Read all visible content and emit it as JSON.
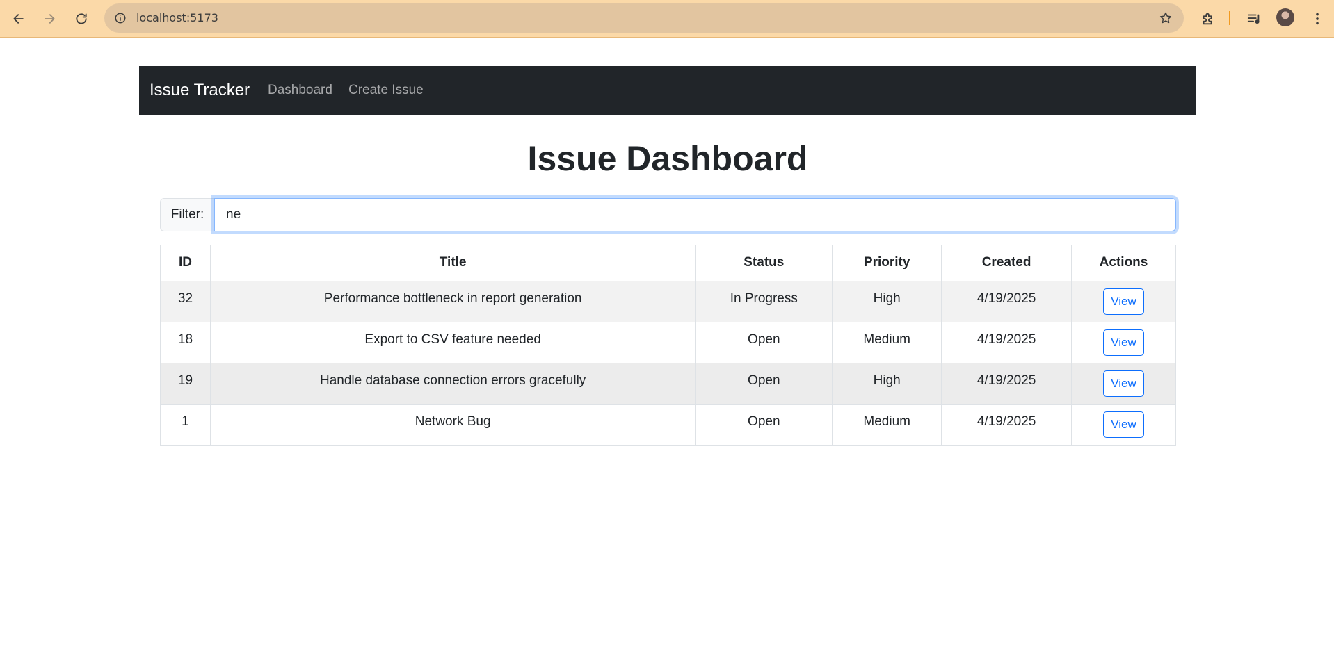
{
  "browser": {
    "url": "localhost:5173"
  },
  "navbar": {
    "brand": "Issue Tracker",
    "links": [
      "Dashboard",
      "Create Issue"
    ]
  },
  "page": {
    "title": "Issue Dashboard"
  },
  "filter": {
    "label": "Filter:",
    "value": "ne"
  },
  "table": {
    "headers": [
      "ID",
      "Title",
      "Status",
      "Priority",
      "Created",
      "Actions"
    ],
    "rows": [
      {
        "id": "32",
        "title": "Performance bottleneck in report generation",
        "status": "In Progress",
        "priority": "High",
        "created": "4/19/2025",
        "action": "View"
      },
      {
        "id": "18",
        "title": "Export to CSV feature needed",
        "status": "Open",
        "priority": "Medium",
        "created": "4/19/2025",
        "action": "View"
      },
      {
        "id": "19",
        "title": "Handle database connection errors gracefully",
        "status": "Open",
        "priority": "High",
        "created": "4/19/2025",
        "action": "View"
      },
      {
        "id": "1",
        "title": "Network Bug",
        "status": "Open",
        "priority": "Medium",
        "created": "4/19/2025",
        "action": "View"
      }
    ]
  },
  "colors": {
    "browser_bar": "#fbd9a8",
    "navbar": "#212529",
    "primary": "#0d6efd"
  }
}
